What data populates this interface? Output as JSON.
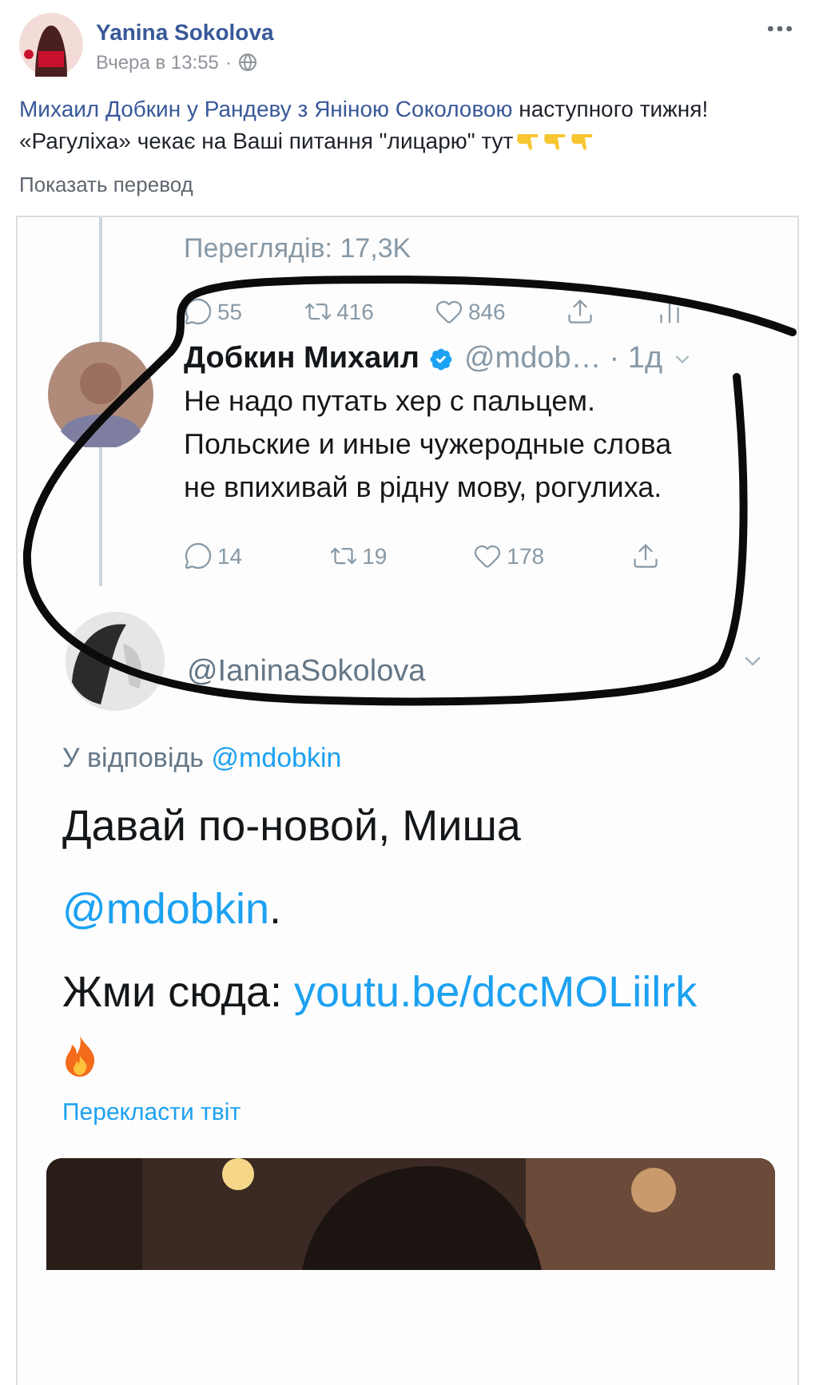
{
  "post": {
    "author": "Yanina Sokolova",
    "time": "Вчера в 13:55",
    "separator": "·",
    "lines": [
      [
        {
          "kind": "link",
          "text": "Михаил Добкин у Рандеву з Яніною Соколовою"
        },
        {
          "kind": "text",
          "text": " наступного тижня!"
        }
      ],
      [
        {
          "kind": "text",
          "text": "«Рагуліха» чекає на Ваші питання \"лицарю\" тут"
        },
        {
          "kind": "hand"
        },
        {
          "kind": "hand"
        },
        {
          "kind": "hand"
        }
      ]
    ],
    "translate": "Показать перевод"
  },
  "shot": {
    "views": "Переглядів: 17,3K",
    "top_actions": [
      {
        "kind": "reply",
        "count": "55"
      },
      {
        "kind": "retweet",
        "count": "416"
      },
      {
        "kind": "like",
        "count": "846"
      },
      {
        "kind": "share"
      },
      {
        "kind": "stats"
      }
    ],
    "tweet": {
      "name": "Добкин Михаил",
      "verified": true,
      "handle": "@mdob…",
      "time": "· 1д",
      "text": "Не надо путать хер с пальцем. Польские и иные чужеродные слова не впихивай в рідну мову, рогулиха.",
      "actions": [
        {
          "kind": "reply",
          "count": "14"
        },
        {
          "kind": "retweet",
          "count": "19"
        },
        {
          "kind": "like",
          "count": "178"
        },
        {
          "kind": "share"
        }
      ]
    },
    "reply": {
      "handle": "@IaninaSokolova",
      "reply_label": "У відповідь",
      "reply_to": "@mdobkin",
      "body": [
        [
          {
            "kind": "text",
            "text": "Давай по-новой, Миша"
          }
        ],
        [
          {
            "kind": "link",
            "text": "@mdobkin"
          },
          {
            "kind": "text",
            "text": "."
          }
        ],
        [
          {
            "kind": "text",
            "text": "Жми сюда: "
          },
          {
            "kind": "link",
            "text": "youtu.be/dccMOLiilrk"
          }
        ],
        [
          {
            "kind": "fire"
          }
        ]
      ],
      "translate": "Перекласти твіт",
      "media": {
        "kind": "picture"
      }
    }
  }
}
